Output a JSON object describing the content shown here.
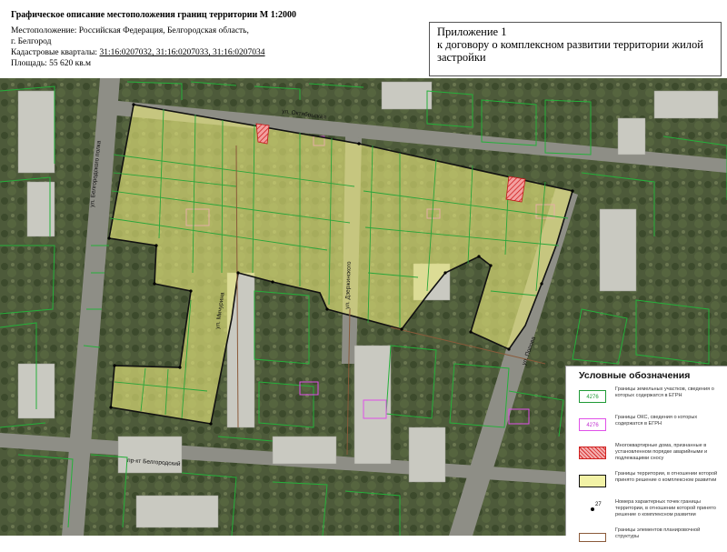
{
  "header": {
    "title": "Графическое описание местоположения границ территории М 1:2000",
    "location_label": "Местоположение:",
    "location_value": "Российская Федерация, Белгородская область,",
    "location_city": "г. Белгород",
    "quarters_label": "Кадастровые кварталы:",
    "quarters_value": "31:16:0207032, 31:16:0207033, 31:16:0207034",
    "area_label": "Площадь:",
    "area_value": "55 620 кв.м"
  },
  "annex": {
    "line1": "Приложение 1",
    "line2": "к договору о комплексном развитии территории жилой",
    "line3": "застройки"
  },
  "map": {
    "street_labels": [
      "ул. Октябрьская",
      "ул. Белгородского полка",
      "ул. Мичурина",
      "ул. Дзержинского",
      "ул. Попова",
      "пр-кт Белгородский"
    ]
  },
  "legend": {
    "title": "Условные обозначения",
    "items": [
      {
        "swatch_text": "4276",
        "text": "Границы земельных участков, сведения о которых содержатся в ЕГРН"
      },
      {
        "swatch_text": "4276",
        "text": "Границы ОКС, сведения о которых содержатся в ЕГРН"
      },
      {
        "swatch_text": "",
        "text": "Многоквартирные дома, признанные в установленном порядке аварийными и подлежащими сносу"
      },
      {
        "swatch_text": "",
        "text": "Границы территории, в отношении которой принято решение о комплексном развитии"
      },
      {
        "swatch_text": "27",
        "text": "Номера характерных точек границы территории, в отношении которой принято решение о комплексном развитии"
      },
      {
        "swatch_text": "",
        "text": "Границы элементов планировочной структуры"
      }
    ]
  },
  "colors": {
    "parcel_border": "#1f9a35",
    "oks_border": "#e050e8",
    "emergency_fill": "#d62a2a",
    "territory_fill": "#f2f2a6",
    "territory_border": "#111111",
    "block_border": "#8a5a3a"
  }
}
